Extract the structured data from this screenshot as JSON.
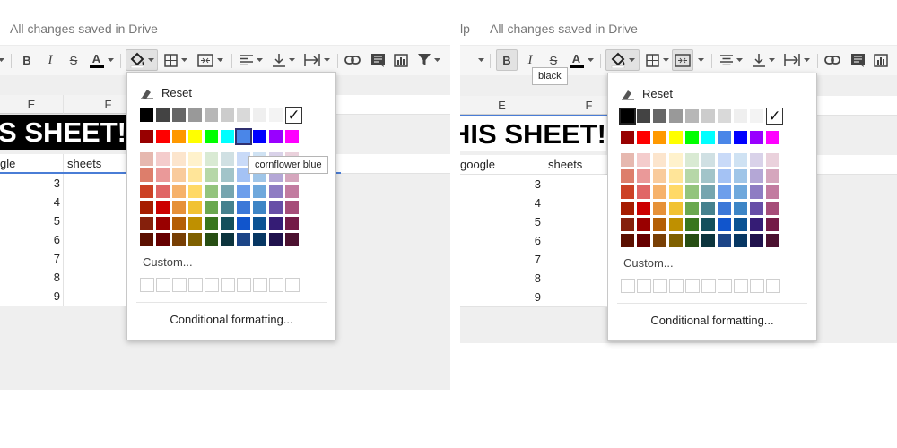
{
  "left": {
    "status": "All changes saved in Drive",
    "grid": {
      "columns": [
        "E",
        "F"
      ],
      "banner": "S SHEET!",
      "header_cells": [
        "gle",
        "sheets"
      ],
      "row_values": [
        "3",
        "4",
        "5",
        "6",
        "7",
        "8",
        "9"
      ]
    },
    "popup": {
      "reset_label": "Reset",
      "custom_label": "Custom...",
      "conditional_label": "Conditional formatting..."
    },
    "tooltip": "cornflower blue"
  },
  "right": {
    "menu_fragment": "lp",
    "status": "All changes saved in Drive",
    "grid": {
      "columns": [
        "E",
        "F"
      ],
      "banner": "HIS SHEET!",
      "header_cells": [
        "google",
        "sheets"
      ],
      "row_values": [
        "3",
        "4",
        "5",
        "6",
        "7",
        "8",
        "9"
      ]
    },
    "popup": {
      "reset_label": "Reset",
      "custom_label": "Custom...",
      "conditional_label": "Conditional formatting..."
    },
    "tooltip": "black"
  },
  "palette": {
    "grays": [
      "#000000",
      "#434343",
      "#666666",
      "#999999",
      "#b7b7b7",
      "#cccccc",
      "#d9d9d9",
      "#efefef",
      "#f3f3f3",
      "#ffffff"
    ],
    "brights": [
      "#980000",
      "#ff0000",
      "#ff9900",
      "#ffff00",
      "#00ff00",
      "#00ffff",
      "#4a86e8",
      "#0000ff",
      "#9900ff",
      "#ff00ff"
    ],
    "shades": [
      [
        "#e6b8af",
        "#f4cccc",
        "#fce5cd",
        "#fff2cc",
        "#d9ead3",
        "#d0e0e3",
        "#c9daf8",
        "#cfe2f3",
        "#d9d2e9",
        "#ead1dc"
      ],
      [
        "#dd7e6b",
        "#ea9999",
        "#f9cb9c",
        "#ffe599",
        "#b6d7a8",
        "#a2c4c9",
        "#a4c2f4",
        "#9fc5e8",
        "#b4a7d6",
        "#d5a6bd"
      ],
      [
        "#cc4125",
        "#e06666",
        "#f6b26b",
        "#ffd966",
        "#93c47d",
        "#76a5af",
        "#6d9eeb",
        "#6fa8dc",
        "#8e7cc3",
        "#c27ba0"
      ],
      [
        "#a61c00",
        "#cc0000",
        "#e69138",
        "#f1c232",
        "#6aa84f",
        "#45818e",
        "#3c78d8",
        "#3d85c6",
        "#674ea7",
        "#a64d79"
      ],
      [
        "#85200c",
        "#990000",
        "#b45f06",
        "#bf9000",
        "#38761d",
        "#134f5c",
        "#1155cc",
        "#0b5394",
        "#351c75",
        "#741b47"
      ],
      [
        "#5b0f00",
        "#660000",
        "#783f04",
        "#7f6000",
        "#274e13",
        "#0c343d",
        "#1c4587",
        "#073763",
        "#20124d",
        "#4c1130"
      ]
    ]
  },
  "icons": {
    "bold": "B",
    "italic": "I",
    "strike": "S",
    "text_color": "A",
    "checkmark": "✓"
  }
}
